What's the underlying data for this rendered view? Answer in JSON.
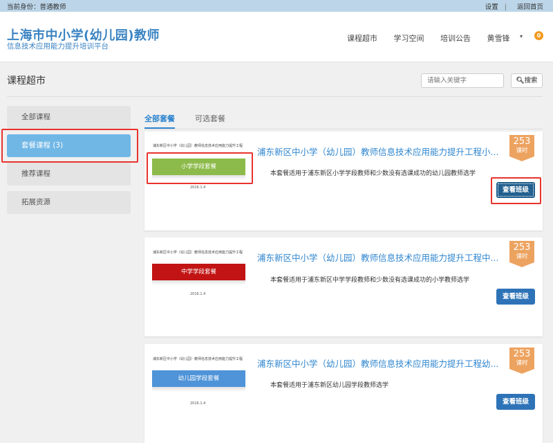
{
  "topbar": {
    "identity": "当前身份：普通教师",
    "settings": "设置",
    "separator": "|",
    "home": "返回首页"
  },
  "brand": {
    "title": "上海市中小学(幼儿园)教师",
    "subtitle": "信息技术应用能力提升培训平台"
  },
  "nav": {
    "items": [
      "课程超市",
      "学习空间",
      "培训公告"
    ],
    "user": "黄雪锋",
    "caret": "▾",
    "badge": "0"
  },
  "page": {
    "title": "课程超市"
  },
  "search": {
    "placeholder": "请输入关键字",
    "icon": "search-icon",
    "button_label": "搜索"
  },
  "sidebar": {
    "items": [
      {
        "label": "全部课程"
      },
      {
        "label": "套餐课程 (3)",
        "active": true
      },
      {
        "label": "推荐课程"
      },
      {
        "label": "拓展资源"
      }
    ]
  },
  "tabs": [
    {
      "label": "全部套餐",
      "active": true
    },
    {
      "label": "可选套餐"
    }
  ],
  "packages": [
    {
      "thumb_title": "浦东新区中小学（幼儿园）教师信息技术应用能力提升工程",
      "thumb_banner": "小学学段套餐",
      "thumb_color": "#8dbb4b",
      "thumb_footer": "2016.1.4",
      "title": "浦东新区中小学（幼儿园）教师信息技术应用能力提升工程小...",
      "description": "本套餐适用于浦东新区小学学段教师和少数没有选课成功的幼儿园教师选学",
      "hours": "253",
      "hours_unit": "课时",
      "button": "查看班级"
    },
    {
      "thumb_title": "浦东新区中小学（幼儿园）教师信息技术应用能力提升工程",
      "thumb_banner": "中学学段套餐",
      "thumb_color": "#c21414",
      "thumb_footer": "2016.1.4",
      "title": "浦东新区中小学（幼儿园）教师信息技术应用能力提升工程中...",
      "description": "本套餐适用于浦东新区中学学段教师和少数没有选课成功的小学教师选学",
      "hours": "253",
      "hours_unit": "课时",
      "button": "查看班级"
    },
    {
      "thumb_title": "浦东新区中小学（幼儿园）教师信息技术应用能力提升工程",
      "thumb_banner": "幼儿园学段套餐",
      "thumb_color": "#4f93d8",
      "thumb_footer": "2016.1.4",
      "title": "浦东新区中小学（幼儿园）教师信息技术应用能力提升工程幼...",
      "description": "本套餐适用于浦东新区幼儿园学段教师选学",
      "hours": "253",
      "hours_unit": "课时",
      "button": "查看班级"
    }
  ],
  "colors": {
    "accent": "#2f86cf",
    "sidebar_active": "#70b7e6",
    "hours_badge": "#eda360",
    "button": "#2e73b7",
    "highlight": "#e8322c"
  }
}
